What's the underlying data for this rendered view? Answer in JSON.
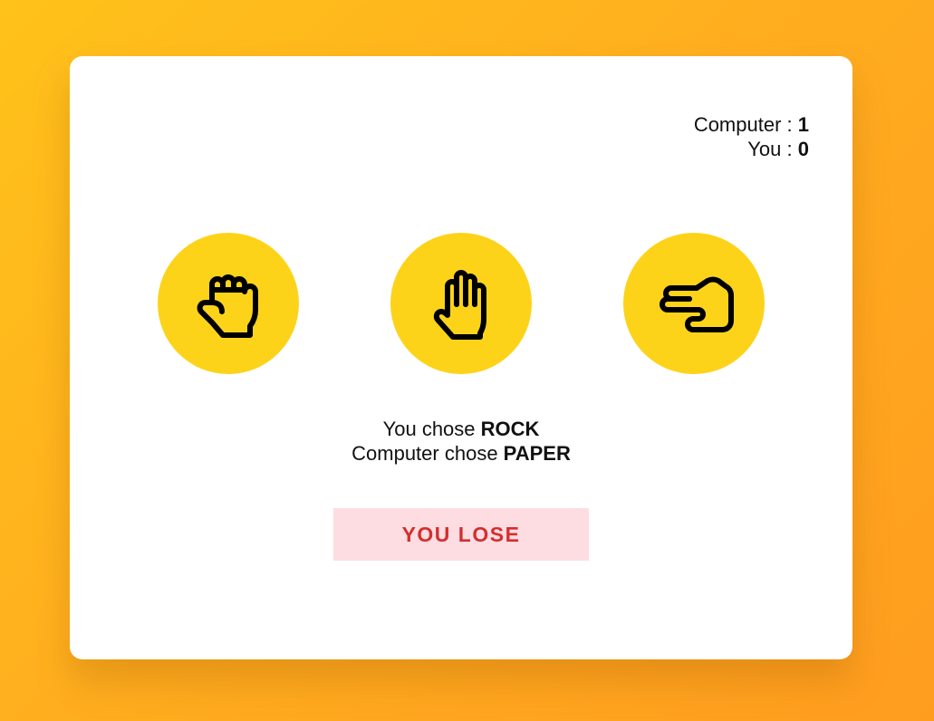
{
  "scoreboard": {
    "computer_label": "Computer : ",
    "computer_score": "1",
    "you_label": "You : ",
    "you_score": "0"
  },
  "choices": [
    {
      "name": "rock",
      "icon": "fist-icon"
    },
    {
      "name": "paper",
      "icon": "open-hand-icon"
    },
    {
      "name": "scissors",
      "icon": "scissors-hand-icon"
    }
  ],
  "result": {
    "you_chose_prefix": "You chose ",
    "you_chose_value": "ROCK",
    "computer_chose_prefix": "Computer chose ",
    "computer_chose_value": "PAPER",
    "outcome": "YOU LOSE"
  },
  "colors": {
    "background_start": "#ffc21a",
    "background_end": "#ff9d1f",
    "choice_circle": "#fdd31a",
    "outcome_bg": "#fddde2",
    "outcome_text": "#d32f2f"
  }
}
